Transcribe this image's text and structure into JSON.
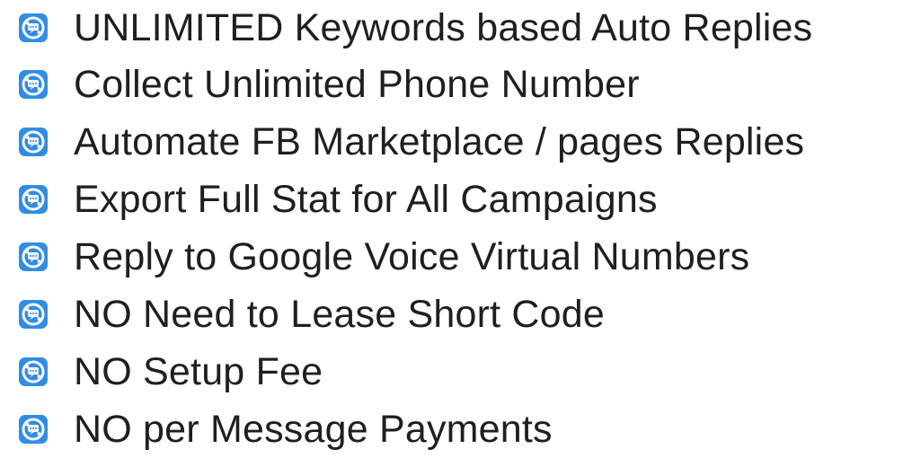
{
  "colors": {
    "icon_background": "#2f8de4",
    "icon_ring": "#f7f7f7",
    "text": "#1f1f1f"
  },
  "features": [
    {
      "icon": "chat-refresh-icon",
      "text": "UNLIMITED Keywords based Auto Replies"
    },
    {
      "icon": "chat-refresh-icon",
      "text": "Collect Unlimited Phone Number"
    },
    {
      "icon": "chat-refresh-icon",
      "text": "Automate FB Marketplace / pages Replies"
    },
    {
      "icon": "chat-refresh-icon",
      "text": "Export Full Stat for All Campaigns"
    },
    {
      "icon": "chat-refresh-icon",
      "text": "Reply to Google Voice Virtual Numbers"
    },
    {
      "icon": "chat-refresh-icon",
      "text": "NO Need to Lease Short Code"
    },
    {
      "icon": "chat-refresh-icon",
      "text": "NO Setup Fee"
    },
    {
      "icon": "chat-refresh-icon",
      "text": "NO per Message Payments"
    }
  ]
}
